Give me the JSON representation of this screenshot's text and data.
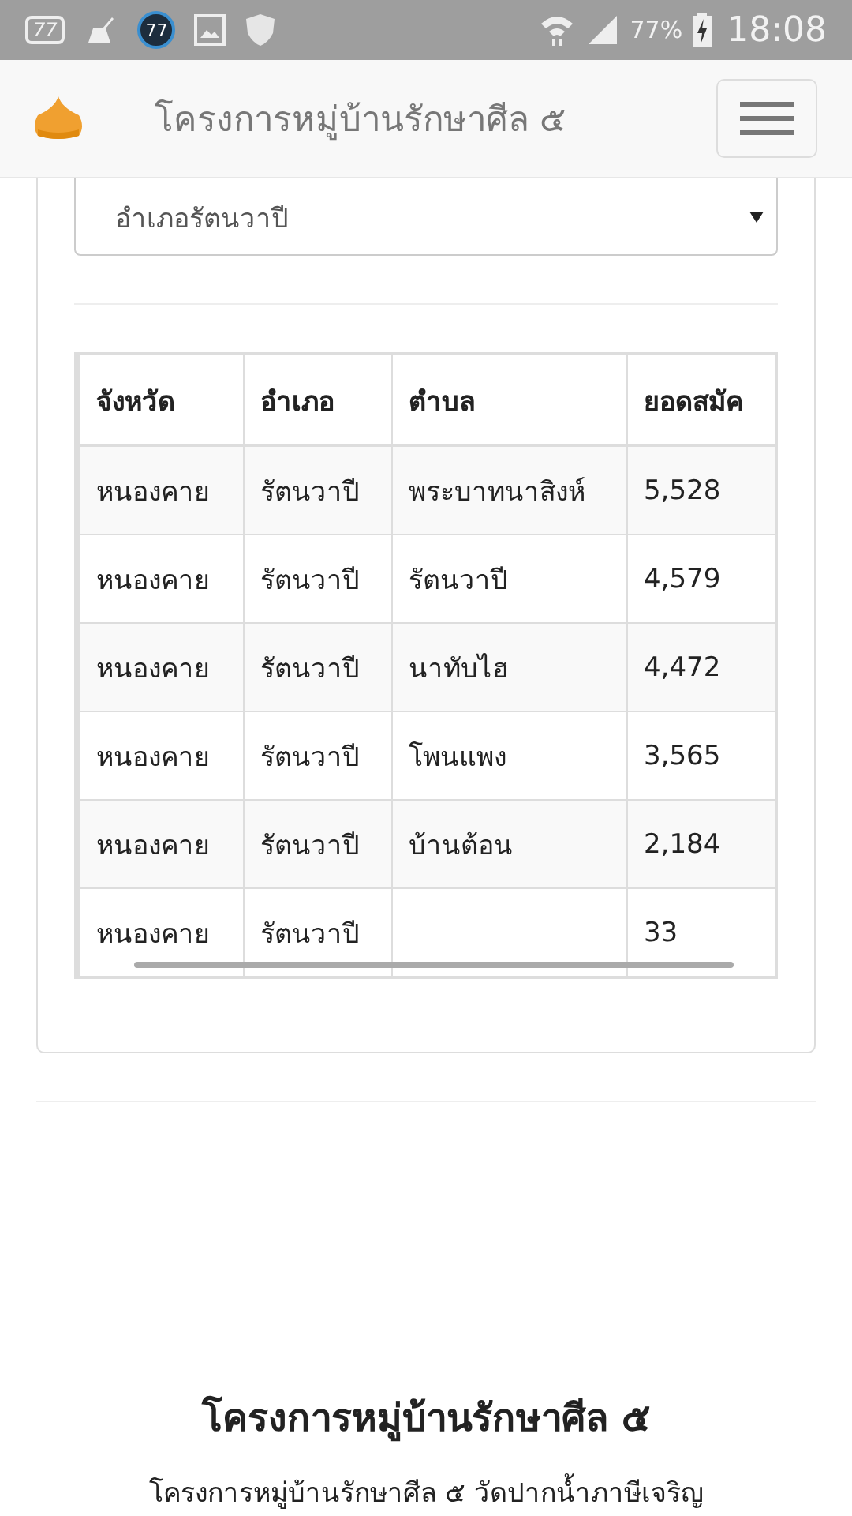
{
  "status_bar": {
    "notif_box_text": "77",
    "notif_badge_text": "77",
    "battery": "77%",
    "time": "18:08"
  },
  "navbar": {
    "title": "โครงการหมู่บ้านรักษาศีล ๕"
  },
  "filter": {
    "value": "อำเภอรัตนวาปี"
  },
  "table": {
    "columns": [
      "จังหวัด",
      "อำเภอ",
      "ตำบล",
      "ยอดสมัค"
    ],
    "rows": [
      [
        "หนองคาย",
        "รัตนวาปี",
        "พระบาทนาสิงห์",
        "5,528"
      ],
      [
        "หนองคาย",
        "รัตนวาปี",
        "รัตนวาปี",
        "4,579"
      ],
      [
        "หนองคาย",
        "รัตนวาปี",
        "นาทับไฮ",
        "4,472"
      ],
      [
        "หนองคาย",
        "รัตนวาปี",
        "โพนแพง",
        "3,565"
      ],
      [
        "หนองคาย",
        "รัตนวาปี",
        "บ้านต้อน",
        "2,184"
      ],
      [
        "หนองคาย",
        "รัตนวาปี",
        "",
        "33"
      ]
    ]
  },
  "footer": {
    "title": "โครงการหมู่บ้านรักษาศีล ๕",
    "subtitle": "โครงการหมู่บ้านรักษาศีล ๕ วัดปากน้ำภาษีเจริญ"
  }
}
